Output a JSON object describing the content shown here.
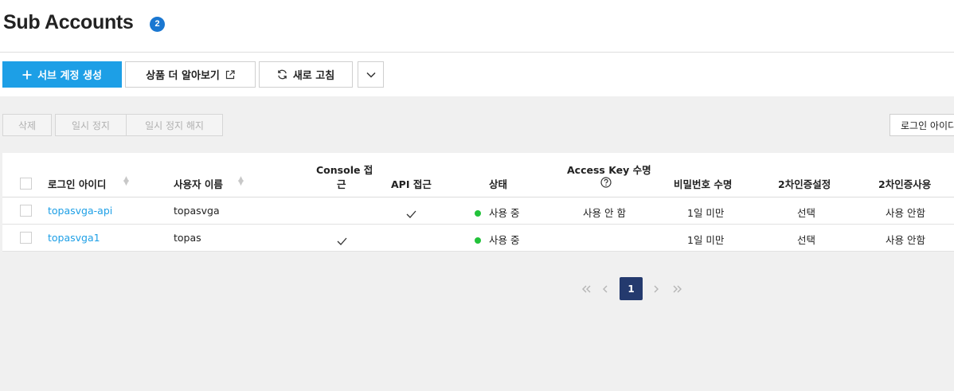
{
  "header": {
    "title": "Sub Accounts",
    "count": "2"
  },
  "toolbar": {
    "create_label": "서브 계정 생성",
    "learn_more_label": "상품 더 알아보기",
    "refresh_label": "새로 고침"
  },
  "actions": {
    "delete_label": "삭제",
    "suspend_label": "일시 정지",
    "unsuspend_label": "일시 정지 해지",
    "search_select_label": "로그인 아이디"
  },
  "table": {
    "columns": {
      "login_id": "로그인 아이디",
      "user_name": "사용자 이름",
      "console_access_1": "Console 접",
      "console_access_2": "근",
      "api_access": "API 접근",
      "status": "상태",
      "access_key_expiry": "Access Key 수명",
      "password_expiry": "비밀번호 수명",
      "two_factor_setting": "2차인증설정",
      "two_factor_use": "2차인증사용"
    },
    "rows": [
      {
        "login_id": "topasvga-api",
        "user_name": "topasvga",
        "console_access": false,
        "api_access": true,
        "status": "사용 중",
        "access_key_expiry": "사용 안 함",
        "password_expiry": "1일 미만",
        "two_factor_setting": "선택",
        "two_factor_use": "사용 안함"
      },
      {
        "login_id": "topasvga1",
        "user_name": "topas",
        "console_access": true,
        "api_access": false,
        "status": "사용 중",
        "access_key_expiry": "",
        "password_expiry": "1일 미만",
        "two_factor_setting": "선택",
        "two_factor_use": "사용 안함"
      }
    ]
  },
  "pagination": {
    "current_page": "1"
  },
  "colors": {
    "primary": "#1d9fe6",
    "badge": "#1a77d1",
    "active_page": "#243a6e",
    "status_dot": "#22c23a"
  }
}
